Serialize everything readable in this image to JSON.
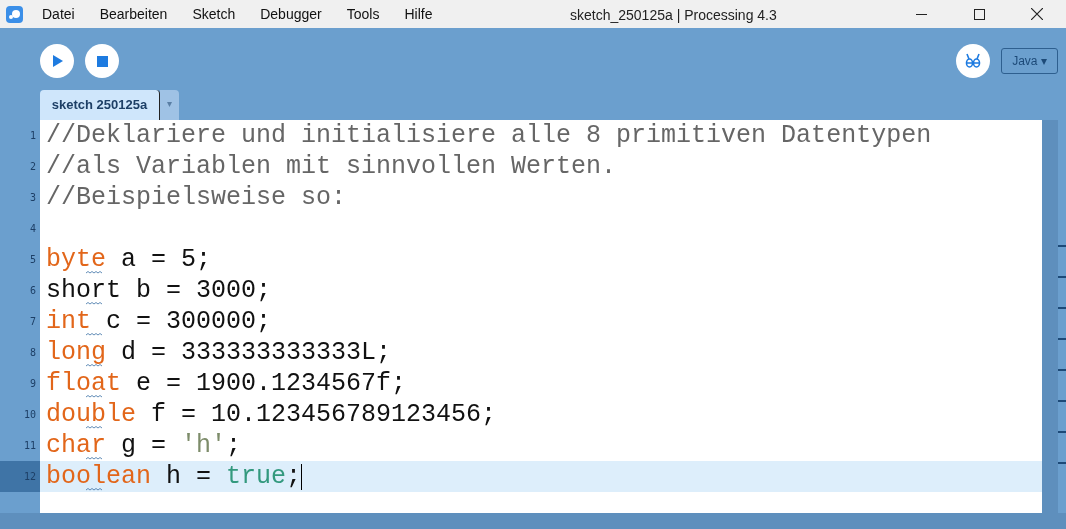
{
  "window": {
    "title": "sketch_250125a | Processing 4.3"
  },
  "menu": [
    "Datei",
    "Bearbeiten",
    "Sketch",
    "Debugger",
    "Tools",
    "Hilfe"
  ],
  "mode": {
    "label": "Java ▾"
  },
  "tabs": [
    {
      "label": "sketch 250125a",
      "selected": true
    }
  ],
  "tab_menu": "▾",
  "editor": {
    "lines": [
      {
        "number": "1",
        "current": false,
        "flagged": false,
        "tokens": [
          {
            "kind": "comment",
            "text": "//Deklariere und initialisiere alle 8 primitiven Datentypen"
          }
        ]
      },
      {
        "number": "2",
        "current": false,
        "flagged": false,
        "tokens": [
          {
            "kind": "comment",
            "text": "//als Variablen mit sinnvollen Werten."
          }
        ]
      },
      {
        "number": "3",
        "current": false,
        "flagged": false,
        "tokens": [
          {
            "kind": "comment",
            "text": "//Beispielsweise so:"
          }
        ]
      },
      {
        "number": "4",
        "current": false,
        "flagged": false
      },
      {
        "number": "5",
        "current": false,
        "flagged": true,
        "tokens": [
          {
            "kind": "keyword",
            "text": "byte"
          },
          {
            "kind": "plain",
            "text": " a = 5;"
          }
        ]
      },
      {
        "number": "6",
        "current": false,
        "flagged": true,
        "tokens": [
          {
            "kind": "plain",
            "text": "short b = 3000;"
          }
        ]
      },
      {
        "number": "7",
        "current": false,
        "flagged": true,
        "tokens": [
          {
            "kind": "keyword",
            "text": "int"
          },
          {
            "kind": "plain",
            "text": " c = 300000;"
          }
        ]
      },
      {
        "number": "8",
        "current": false,
        "flagged": true,
        "tokens": [
          {
            "kind": "keyword",
            "text": "long"
          },
          {
            "kind": "plain",
            "text": " d = 333333333333L;"
          }
        ]
      },
      {
        "number": "9",
        "current": false,
        "flagged": true,
        "tokens": [
          {
            "kind": "keyword",
            "text": "float"
          },
          {
            "kind": "plain",
            "text": " e = 1900.1234567f;"
          }
        ]
      },
      {
        "number": "10",
        "current": false,
        "flagged": true,
        "tokens": [
          {
            "kind": "keyword",
            "text": "double"
          },
          {
            "kind": "plain",
            "text": " f = 10.123456789123456;"
          }
        ]
      },
      {
        "number": "11",
        "current": false,
        "flagged": true,
        "tokens": [
          {
            "kind": "keyword",
            "text": "char"
          },
          {
            "kind": "plain",
            "text": " g = "
          },
          {
            "kind": "string",
            "text": "'h'"
          },
          {
            "kind": "plain",
            "text": ";"
          }
        ]
      },
      {
        "number": "12",
        "current": true,
        "flagged": true,
        "tokens": [
          {
            "kind": "keyword",
            "text": "boolean"
          },
          {
            "kind": "plain",
            "text": " h = "
          },
          {
            "kind": "literal",
            "text": "true"
          },
          {
            "kind": "plain",
            "text": ";"
          }
        ]
      }
    ]
  }
}
